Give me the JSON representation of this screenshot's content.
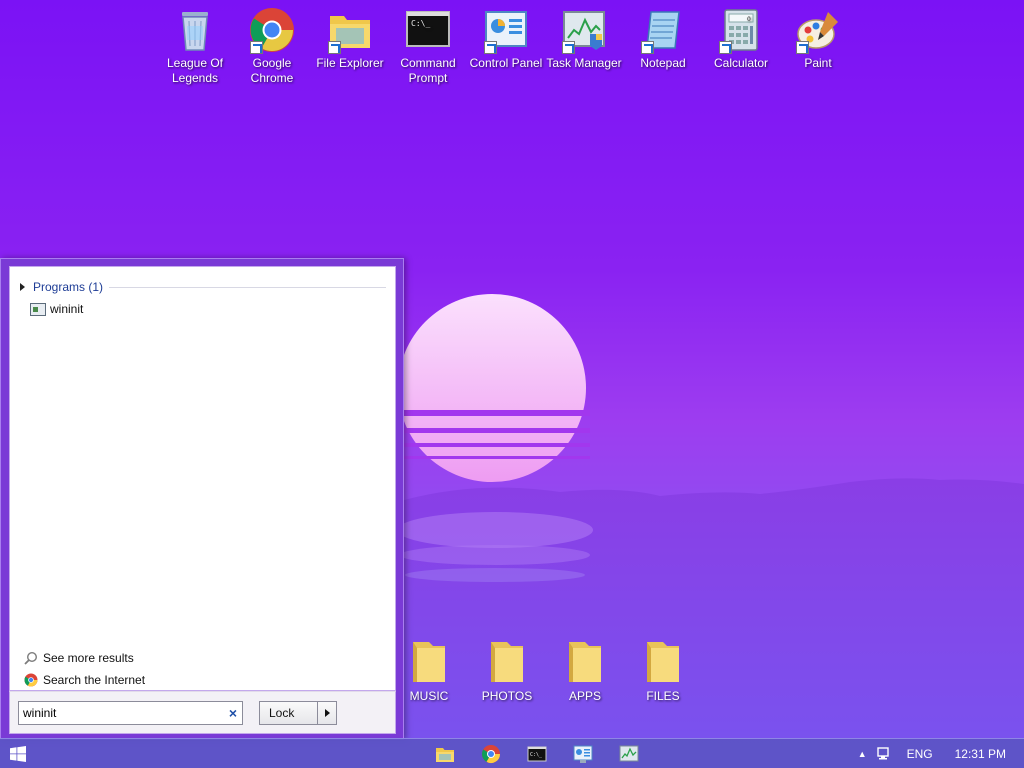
{
  "desktop": {
    "icons": [
      {
        "label": "League Of Legends",
        "icon": "recycle-bin-icon"
      },
      {
        "label": "Google Chrome",
        "icon": "chrome-icon"
      },
      {
        "label": "File Explorer",
        "icon": "file-explorer-icon"
      },
      {
        "label": "Command Prompt",
        "icon": "command-prompt-icon"
      },
      {
        "label": "Control Panel",
        "icon": "control-panel-icon"
      },
      {
        "label": "Task Manager",
        "icon": "task-manager-icon"
      },
      {
        "label": "Notepad",
        "icon": "notepad-icon"
      },
      {
        "label": "Calculator",
        "icon": "calculator-icon"
      },
      {
        "label": "Paint",
        "icon": "paint-icon"
      }
    ],
    "folders": [
      {
        "label": "MUSIC"
      },
      {
        "label": "PHOTOS"
      },
      {
        "label": "APPS"
      },
      {
        "label": "FILES"
      }
    ]
  },
  "start_menu": {
    "group_title": "Programs (1)",
    "results": [
      {
        "label": "wininit"
      }
    ],
    "see_more": "See more results",
    "search_internet": "Search the Internet",
    "search_value": "wininit",
    "lock_label": "Lock"
  },
  "taskbar": {
    "apps": [
      "file-explorer-icon",
      "chrome-icon",
      "command-prompt-icon",
      "control-panel-icon",
      "task-manager-icon"
    ],
    "language": "ENG",
    "time": "12:31 PM"
  },
  "colors": {
    "wallpaper_top": "#7b12f5",
    "sun": "#f5c8f8",
    "taskbar": "#5c52c4",
    "link_blue": "#1e3d96"
  }
}
